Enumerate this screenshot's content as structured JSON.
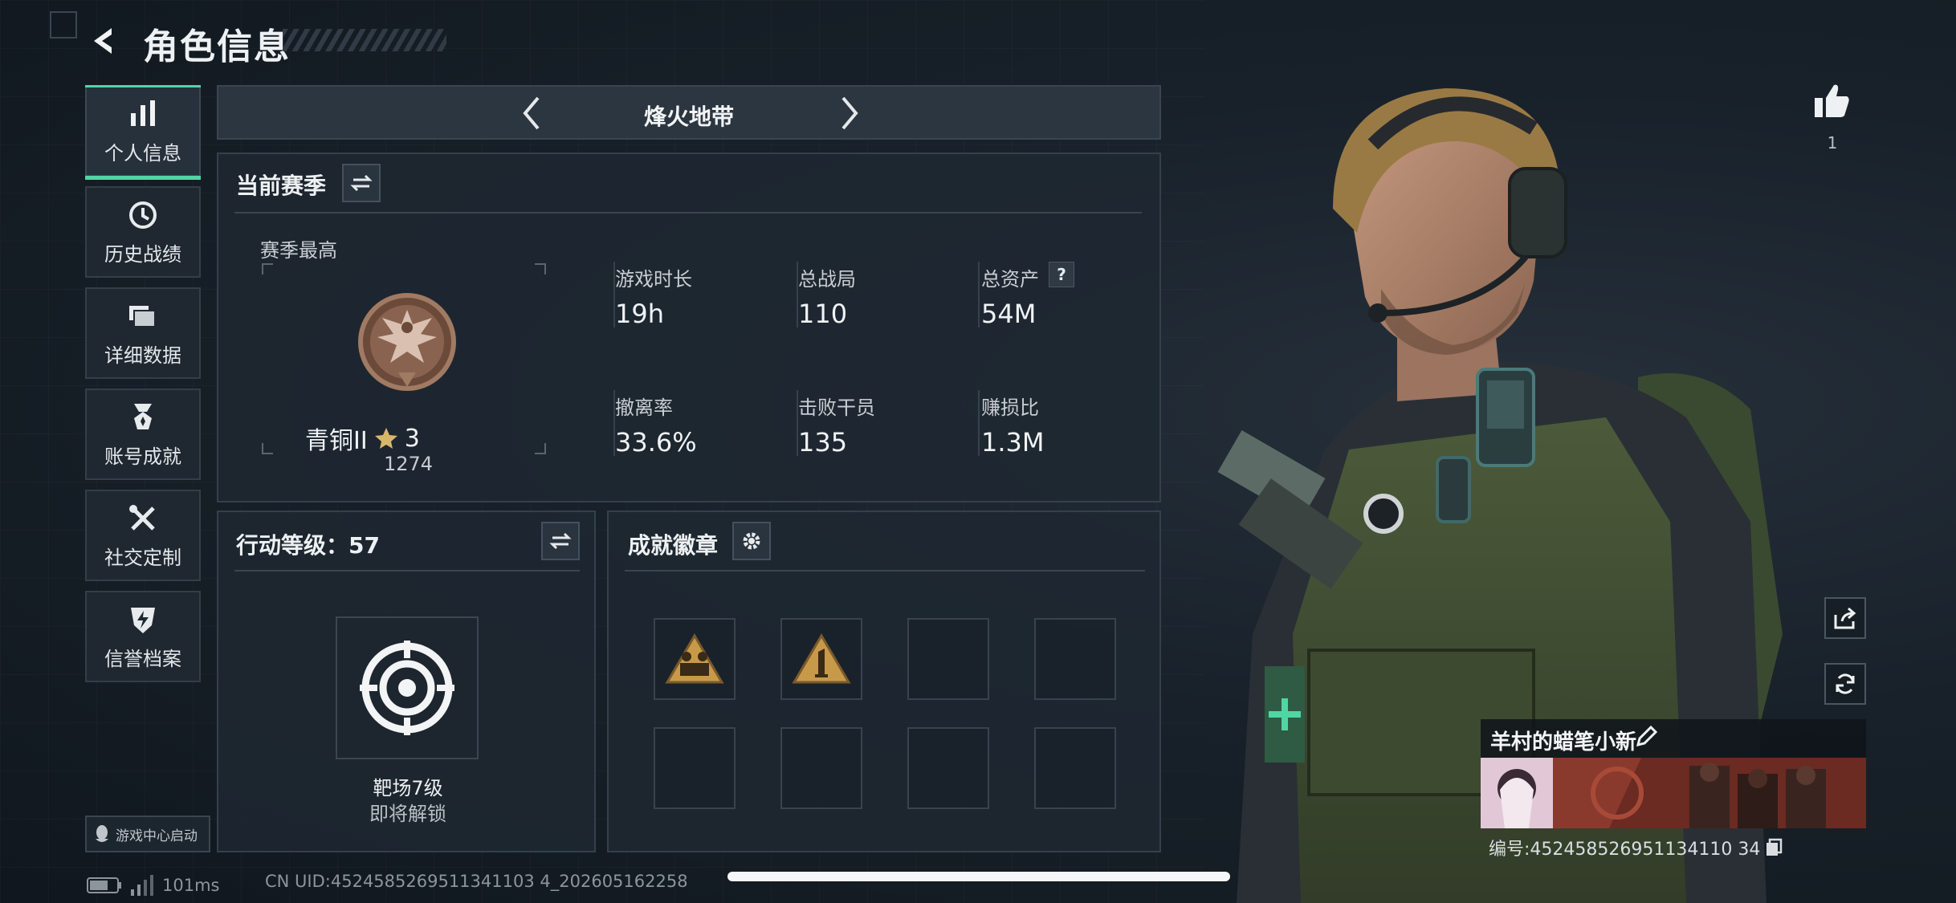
{
  "header": {
    "title": "角色信息"
  },
  "sidebar": {
    "items": [
      {
        "label": "个人信息",
        "icon": "bar-chart-icon",
        "active": true
      },
      {
        "label": "历史战绩",
        "icon": "history-clock-icon",
        "active": false
      },
      {
        "label": "详细数据",
        "icon": "folder-icon",
        "active": false
      },
      {
        "label": "账号成就",
        "icon": "medal-icon",
        "active": false
      },
      {
        "label": "社交定制",
        "icon": "wrench-screwdriver-icon",
        "active": false
      },
      {
        "label": "信誉档案",
        "icon": "shield-lightning-icon",
        "active": false
      }
    ]
  },
  "mode_selector": {
    "current": "烽火地带"
  },
  "season": {
    "title": "当前赛季",
    "best_label": "赛季最高",
    "rank_name": "青铜II",
    "rank_stars": "3",
    "rank_score": "1274",
    "stats": [
      {
        "label": "游戏时长",
        "value": "19h"
      },
      {
        "label": "总战局",
        "value": "110"
      },
      {
        "label": "总资产",
        "value": "54M",
        "help": "?"
      },
      {
        "label": "撤离率",
        "value": "33.6%"
      },
      {
        "label": "击败干员",
        "value": "135"
      },
      {
        "label": "赚损比",
        "value": "1.3M"
      }
    ]
  },
  "action_level": {
    "title": "行动等级：57",
    "item_name": "靶场7级",
    "item_status": "即将解锁"
  },
  "achievements": {
    "title": "成就徽章"
  },
  "player": {
    "likes": "1",
    "name": "羊村的蜡笔小新",
    "id_text": "编号:452458526951134110 34"
  },
  "bottom": {
    "game_center": "游戏中心启动",
    "ping": "101ms",
    "uid": "CN UID:4524585269511341103 4_202605162258"
  },
  "colors": {
    "accent": "#4fd6a4",
    "bronze": "#a07a62"
  }
}
